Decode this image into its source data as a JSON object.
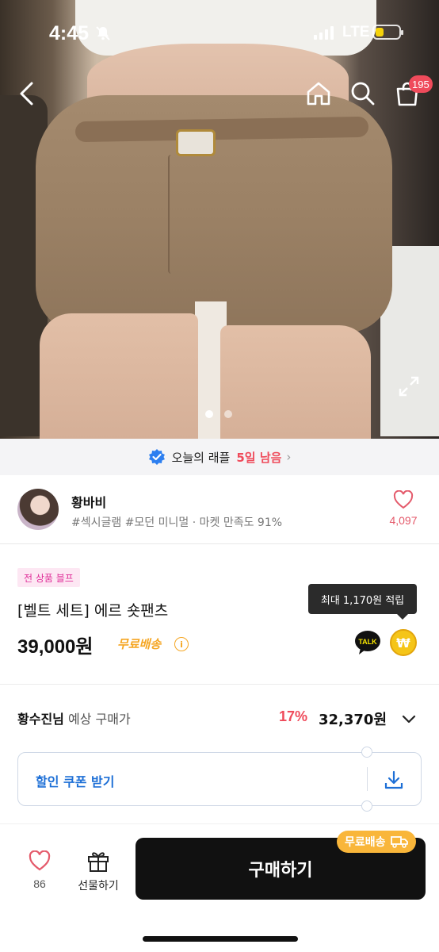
{
  "status_bar": {
    "time": "4:45",
    "network": "LTE"
  },
  "header": {
    "cart_count": "195",
    "icons": [
      "back-icon",
      "home-icon",
      "search-icon",
      "cart-icon"
    ]
  },
  "gallery": {
    "page_count": 2,
    "active_page": 1
  },
  "raffle": {
    "label": "오늘의 래플",
    "days_left": "5일 남음"
  },
  "seller": {
    "name": "황바비",
    "tags": "#섹시글램 #모던 미니멀 · 마켓 만족도 91%",
    "like_count": "4,097"
  },
  "product": {
    "promo_tag": "전 상품 블프",
    "title": "[벨트 세트] 에르 숏팬츠",
    "price": "39,000원",
    "shipping": "무료배송",
    "points_tooltip": "최대 1,170원 적립",
    "talk_label": "TALK",
    "coin_symbol": "₩"
  },
  "expected": {
    "user": "황수진님",
    "label": "예상 구매가",
    "discount": "17%",
    "price": "32,370원"
  },
  "coupon": {
    "label": "할인 쿠폰 받기"
  },
  "bottom_bar": {
    "like_count": "86",
    "gift_label": "선물하기",
    "buy_label": "구매하기",
    "free_badge": "무료배송"
  },
  "colors": {
    "accent_red": "#ef4b5b",
    "coupon_blue": "#1d6fd6",
    "free_orange": "#f5a623",
    "promo_pink": "#e0309a"
  }
}
